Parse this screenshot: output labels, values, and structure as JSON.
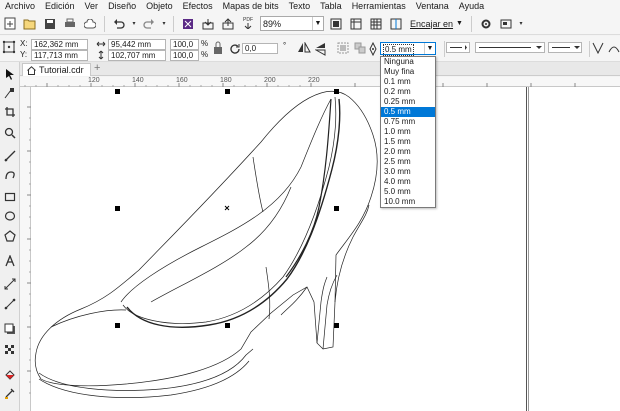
{
  "menu": [
    "Archivo",
    "Edición",
    "Ver",
    "Diseño",
    "Objeto",
    "Efectos",
    "Mapas de bits",
    "Texto",
    "Tabla",
    "Herramientas",
    "Ventana",
    "Ayuda"
  ],
  "toolbar": {
    "zoom": "89%",
    "fit_label": "Encajar en",
    "import_label": "PDF"
  },
  "props": {
    "x_label": "X:",
    "x": "162,362 mm",
    "y_label": "Y:",
    "y": "117,713 mm",
    "w": "95,442 mm",
    "h": "102,707 mm",
    "sx": "100,0",
    "sy": "100,0",
    "pct1": "%",
    "pct2": "%",
    "angle": "0,0",
    "deg": "°"
  },
  "outline": {
    "current": "0.5 mm",
    "options": [
      "Ninguna",
      "Muy fina",
      "0.1 mm",
      "0.2 mm",
      "0.25 mm",
      "0.5 mm",
      "0.75 mm",
      "1.0 mm",
      "1.5 mm",
      "2.0 mm",
      "2.5 mm",
      "3.0 mm",
      "4.0 mm",
      "5.0 mm",
      "10.0 mm"
    ],
    "selected_index": 5
  },
  "document": {
    "tab": "Tutorial.cdr"
  },
  "ruler": {
    "h_ticks": [
      "120",
      "140",
      "160",
      "180",
      "200",
      "220"
    ]
  },
  "colors": {
    "accent": "#0078d7",
    "selection": "#0078d7"
  }
}
